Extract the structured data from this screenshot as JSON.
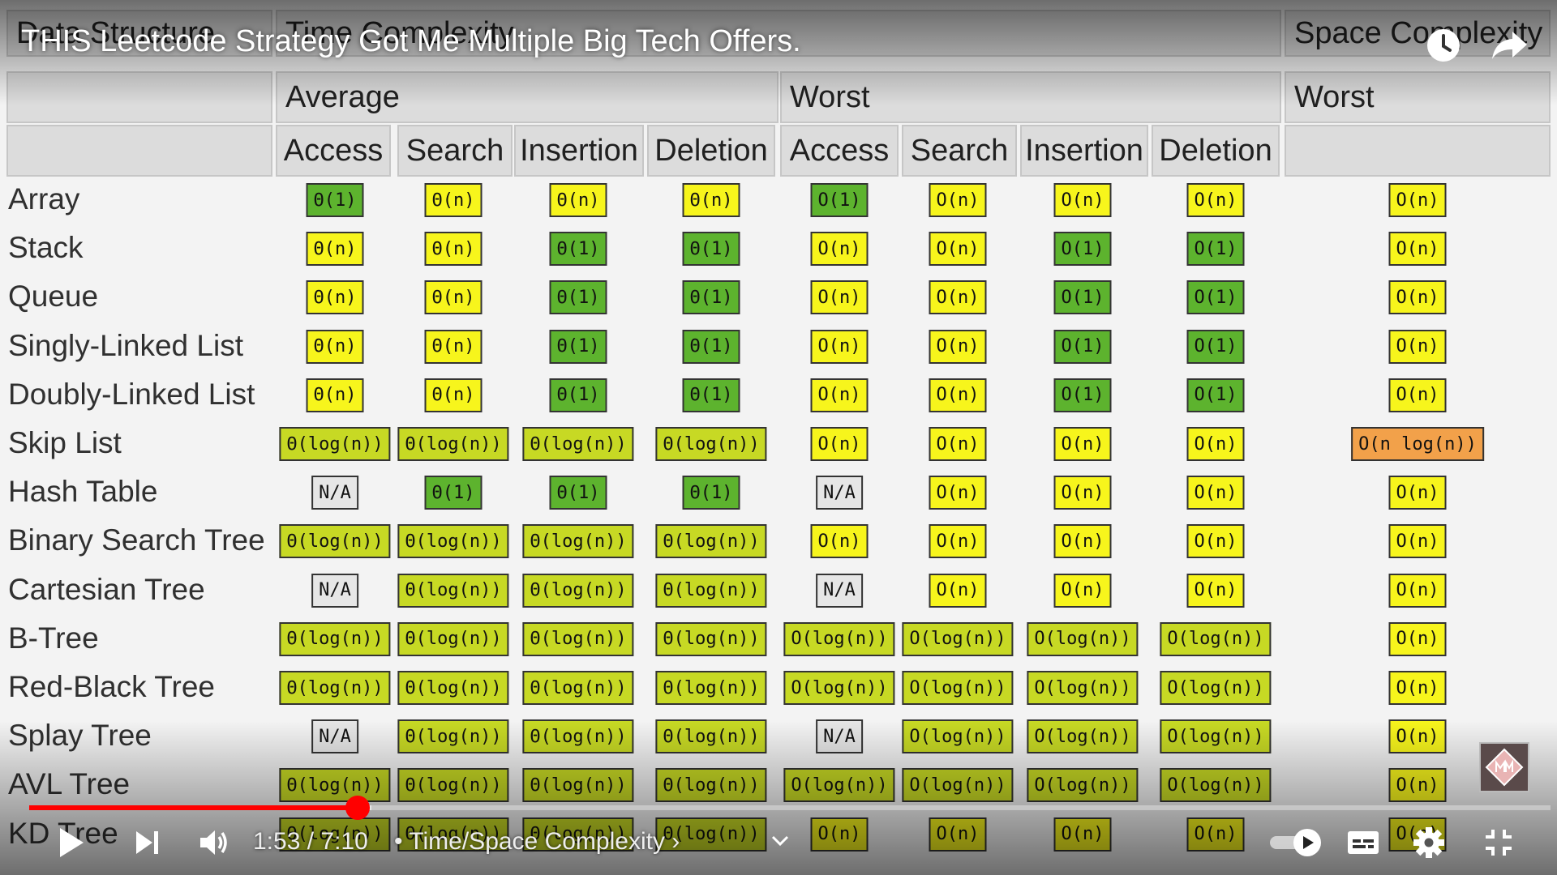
{
  "player": {
    "title": "THIS Leetcode Strategy Got Me Multiple Big Tech Offers.",
    "time": "1:53 / 7:10",
    "chapter": "• Time/Space Complexity",
    "progress_fraction": 0.216,
    "buffered_fraction": 0.225,
    "accent_color": "#ff0000",
    "icons": {
      "watch_later": "clock-icon",
      "share": "share-icon",
      "play": "play-icon",
      "next": "next-icon",
      "volume": "volume-icon",
      "autoplay": "autoplay-toggle-icon",
      "captions": "captions-icon",
      "settings": "gear-icon",
      "exit_fullscreen": "exit-fullscreen-icon"
    }
  },
  "table": {
    "header_row1": {
      "col0": "Data Structure",
      "time": "Time Complexity",
      "space": "Space Complexity"
    },
    "header_row2": {
      "average": "Average",
      "worst": "Worst",
      "space_worst": "Worst"
    },
    "columns": [
      "Access",
      "Search",
      "Insertion",
      "Deletion",
      "Access",
      "Search",
      "Insertion",
      "Deletion",
      ""
    ],
    "rows": [
      {
        "name": "Array",
        "cells": [
          [
            "Θ(1)",
            "green"
          ],
          [
            "Θ(n)",
            "yellow"
          ],
          [
            "Θ(n)",
            "yellow"
          ],
          [
            "Θ(n)",
            "yellow"
          ],
          [
            "O(1)",
            "green"
          ],
          [
            "O(n)",
            "yellow"
          ],
          [
            "O(n)",
            "yellow"
          ],
          [
            "O(n)",
            "yellow"
          ],
          [
            "O(n)",
            "yellow"
          ]
        ]
      },
      {
        "name": "Stack",
        "cells": [
          [
            "Θ(n)",
            "yellow"
          ],
          [
            "Θ(n)",
            "yellow"
          ],
          [
            "Θ(1)",
            "green"
          ],
          [
            "Θ(1)",
            "green"
          ],
          [
            "O(n)",
            "yellow"
          ],
          [
            "O(n)",
            "yellow"
          ],
          [
            "O(1)",
            "green"
          ],
          [
            "O(1)",
            "green"
          ],
          [
            "O(n)",
            "yellow"
          ]
        ]
      },
      {
        "name": "Queue",
        "cells": [
          [
            "Θ(n)",
            "yellow"
          ],
          [
            "Θ(n)",
            "yellow"
          ],
          [
            "Θ(1)",
            "green"
          ],
          [
            "Θ(1)",
            "green"
          ],
          [
            "O(n)",
            "yellow"
          ],
          [
            "O(n)",
            "yellow"
          ],
          [
            "O(1)",
            "green"
          ],
          [
            "O(1)",
            "green"
          ],
          [
            "O(n)",
            "yellow"
          ]
        ]
      },
      {
        "name": "Singly-Linked List",
        "cells": [
          [
            "Θ(n)",
            "yellow"
          ],
          [
            "Θ(n)",
            "yellow"
          ],
          [
            "Θ(1)",
            "green"
          ],
          [
            "Θ(1)",
            "green"
          ],
          [
            "O(n)",
            "yellow"
          ],
          [
            "O(n)",
            "yellow"
          ],
          [
            "O(1)",
            "green"
          ],
          [
            "O(1)",
            "green"
          ],
          [
            "O(n)",
            "yellow"
          ]
        ]
      },
      {
        "name": "Doubly-Linked List",
        "cells": [
          [
            "Θ(n)",
            "yellow"
          ],
          [
            "Θ(n)",
            "yellow"
          ],
          [
            "Θ(1)",
            "green"
          ],
          [
            "Θ(1)",
            "green"
          ],
          [
            "O(n)",
            "yellow"
          ],
          [
            "O(n)",
            "yellow"
          ],
          [
            "O(1)",
            "green"
          ],
          [
            "O(1)",
            "green"
          ],
          [
            "O(n)",
            "yellow"
          ]
        ]
      },
      {
        "name": "Skip List",
        "cells": [
          [
            "Θ(log(n))",
            "lime"
          ],
          [
            "Θ(log(n))",
            "lime"
          ],
          [
            "Θ(log(n))",
            "lime"
          ],
          [
            "Θ(log(n))",
            "lime"
          ],
          [
            "O(n)",
            "yellow"
          ],
          [
            "O(n)",
            "yellow"
          ],
          [
            "O(n)",
            "yellow"
          ],
          [
            "O(n)",
            "yellow"
          ],
          [
            "O(n log(n))",
            "orange"
          ]
        ]
      },
      {
        "name": "Hash Table",
        "cells": [
          [
            "N/A",
            "gray"
          ],
          [
            "Θ(1)",
            "green"
          ],
          [
            "Θ(1)",
            "green"
          ],
          [
            "Θ(1)",
            "green"
          ],
          [
            "N/A",
            "gray"
          ],
          [
            "O(n)",
            "yellow"
          ],
          [
            "O(n)",
            "yellow"
          ],
          [
            "O(n)",
            "yellow"
          ],
          [
            "O(n)",
            "yellow"
          ]
        ]
      },
      {
        "name": "Binary Search Tree",
        "cells": [
          [
            "Θ(log(n))",
            "lime"
          ],
          [
            "Θ(log(n))",
            "lime"
          ],
          [
            "Θ(log(n))",
            "lime"
          ],
          [
            "Θ(log(n))",
            "lime"
          ],
          [
            "O(n)",
            "yellow"
          ],
          [
            "O(n)",
            "yellow"
          ],
          [
            "O(n)",
            "yellow"
          ],
          [
            "O(n)",
            "yellow"
          ],
          [
            "O(n)",
            "yellow"
          ]
        ]
      },
      {
        "name": "Cartesian Tree",
        "cells": [
          [
            "N/A",
            "gray"
          ],
          [
            "Θ(log(n))",
            "lime"
          ],
          [
            "Θ(log(n))",
            "lime"
          ],
          [
            "Θ(log(n))",
            "lime"
          ],
          [
            "N/A",
            "gray"
          ],
          [
            "O(n)",
            "yellow"
          ],
          [
            "O(n)",
            "yellow"
          ],
          [
            "O(n)",
            "yellow"
          ],
          [
            "O(n)",
            "yellow"
          ]
        ]
      },
      {
        "name": "B-Tree",
        "cells": [
          [
            "Θ(log(n))",
            "lime"
          ],
          [
            "Θ(log(n))",
            "lime"
          ],
          [
            "Θ(log(n))",
            "lime"
          ],
          [
            "Θ(log(n))",
            "lime"
          ],
          [
            "O(log(n))",
            "lime"
          ],
          [
            "O(log(n))",
            "lime"
          ],
          [
            "O(log(n))",
            "lime"
          ],
          [
            "O(log(n))",
            "lime"
          ],
          [
            "O(n)",
            "yellow"
          ]
        ]
      },
      {
        "name": "Red-Black Tree",
        "cells": [
          [
            "Θ(log(n))",
            "lime"
          ],
          [
            "Θ(log(n))",
            "lime"
          ],
          [
            "Θ(log(n))",
            "lime"
          ],
          [
            "Θ(log(n))",
            "lime"
          ],
          [
            "O(log(n))",
            "lime"
          ],
          [
            "O(log(n))",
            "lime"
          ],
          [
            "O(log(n))",
            "lime"
          ],
          [
            "O(log(n))",
            "lime"
          ],
          [
            "O(n)",
            "yellow"
          ]
        ]
      },
      {
        "name": "Splay Tree",
        "cells": [
          [
            "N/A",
            "gray"
          ],
          [
            "Θ(log(n))",
            "lime"
          ],
          [
            "Θ(log(n))",
            "lime"
          ],
          [
            "Θ(log(n))",
            "lime"
          ],
          [
            "N/A",
            "gray"
          ],
          [
            "O(log(n))",
            "lime"
          ],
          [
            "O(log(n))",
            "lime"
          ],
          [
            "O(log(n))",
            "lime"
          ],
          [
            "O(n)",
            "yellow"
          ]
        ]
      },
      {
        "name": "AVL Tree",
        "cells": [
          [
            "Θ(log(n))",
            "lime"
          ],
          [
            "Θ(log(n))",
            "lime"
          ],
          [
            "Θ(log(n))",
            "lime"
          ],
          [
            "Θ(log(n))",
            "lime"
          ],
          [
            "O(log(n))",
            "lime"
          ],
          [
            "O(log(n))",
            "lime"
          ],
          [
            "O(log(n))",
            "lime"
          ],
          [
            "O(log(n))",
            "lime"
          ],
          [
            "O(n)",
            "yellow"
          ]
        ]
      },
      {
        "name": "KD Tree",
        "cells": [
          [
            "Θ(log(n))",
            "lime"
          ],
          [
            "Θ(log(n))",
            "lime"
          ],
          [
            "Θ(log(n))",
            "lime"
          ],
          [
            "Θ(log(n))",
            "lime"
          ],
          [
            "O(n)",
            "yellow"
          ],
          [
            "O(n)",
            "yellow"
          ],
          [
            "O(n)",
            "yellow"
          ],
          [
            "O(n)",
            "yellow"
          ],
          [
            "O(n)",
            "yellow"
          ]
        ]
      }
    ]
  }
}
